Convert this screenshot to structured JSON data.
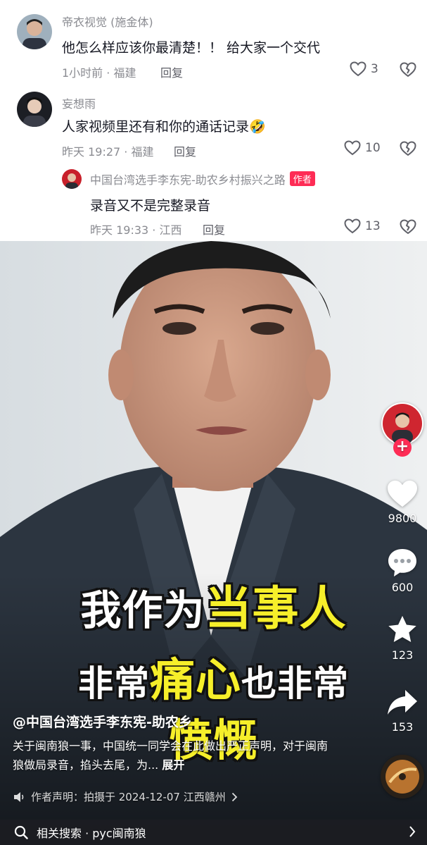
{
  "comments": [
    {
      "user": "帝衣视觉 (施金体)",
      "text": "他怎么样应该你最清楚！！ 给大家一个交代",
      "time_location": "1小时前 · 福建",
      "reply_label": "回复",
      "likes": "3"
    },
    {
      "user": "妄想雨",
      "text": "人家视频里还有和你的通话记录🤣",
      "time_location": "昨天 19:27 · 福建",
      "reply_label": "回复",
      "likes": "10"
    },
    {
      "user": "中国台湾选手李东宪-助农乡村振兴之路",
      "author_tag": "作者",
      "text": "录音又不是完整录音",
      "time_location": "昨天 19:33 · 江西",
      "reply_label": "回复",
      "likes": "13"
    }
  ],
  "video": {
    "caption_lines": {
      "line1_white": "我作为",
      "line1_yellow": "当事人",
      "line2_white_a": "非常",
      "line2_yellow": "痛心",
      "line2_white_b": "也非常",
      "line3_yellow": "愤慨"
    },
    "author": "@中国台湾选手李东宪-助农乡",
    "description": "关于闽南狼一事，中国统一同学会在此做出严正声明，对于闽南狼做局录音，掐头去尾，为...",
    "expand_label": "展开",
    "statement": "作者声明：拍摄于 2024-12-07 江西赣州"
  },
  "rail": {
    "follow_symbol": "+",
    "like_count": "9800",
    "comment_count": "600",
    "favorite_count": "123",
    "share_count": "153"
  },
  "search": {
    "text": "相关搜索 · pyc闽南狼"
  },
  "colors": {
    "accent": "#fe2c55",
    "caption_yellow": "#f6ef2a",
    "meta_gray": "#8a8b91"
  }
}
